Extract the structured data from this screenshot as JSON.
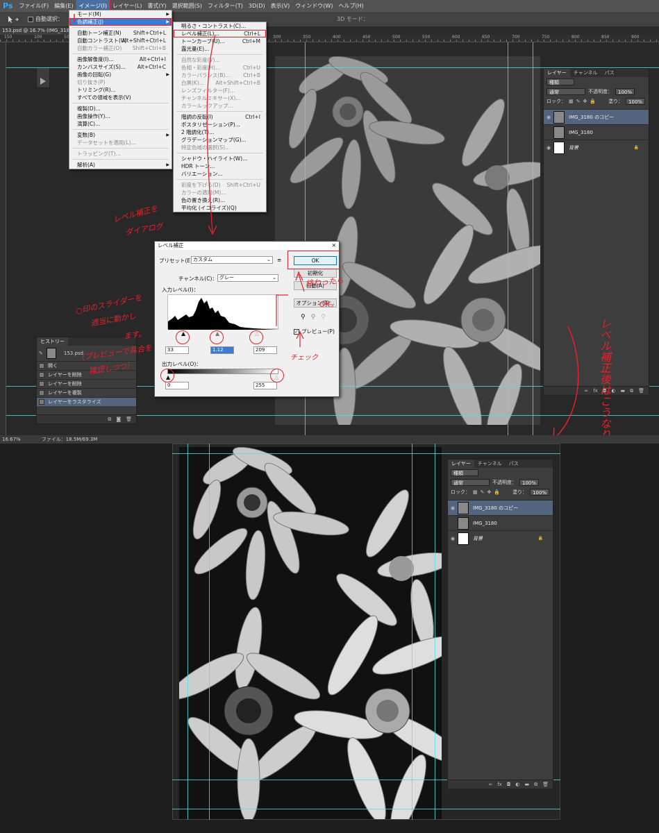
{
  "menubar": {
    "logo": "Ps",
    "items": [
      "ファイル(F)",
      "編集(E)",
      "イメージ(I)",
      "レイヤー(L)",
      "書式(Y)",
      "選択範囲(S)",
      "フィルター(T)",
      "3D(D)",
      "表示(V)",
      "ウィンドウ(W)",
      "ヘルプ(H)"
    ]
  },
  "optbar": {
    "auto_select": "自動選択：",
    "mode3d": "3D モード："
  },
  "doc_tab": "153.psd @ 16.7% (IMG_3180",
  "ruler_numbers": [
    "150",
    "100",
    "50",
    "0",
    "50",
    "100",
    "150",
    "200",
    "250",
    "300",
    "350",
    "400",
    "450",
    "500",
    "550",
    "600",
    "650",
    "700",
    "750",
    "800",
    "850",
    "900",
    "950"
  ],
  "image_menu": {
    "items": [
      {
        "label": "モード(M)",
        "sc": "",
        "arrow": true,
        "state": ""
      },
      {
        "label": "色調補正(J)",
        "sc": "",
        "arrow": true,
        "state": "sel"
      },
      {
        "label": "sep"
      },
      {
        "label": "自動トーン補正(N)",
        "sc": "Shift+Ctrl+L",
        "state": ""
      },
      {
        "label": "自動コントラスト(U)",
        "sc": "Alt+Shift+Ctrl+L",
        "state": ""
      },
      {
        "label": "自動カラー補正(O)",
        "sc": "Shift+Ctrl+B",
        "state": "dis"
      },
      {
        "label": "sep"
      },
      {
        "label": "画像解像度(I)...",
        "sc": "Alt+Ctrl+I",
        "state": ""
      },
      {
        "label": "カンバスサイズ(S)...",
        "sc": "Alt+Ctrl+C",
        "state": ""
      },
      {
        "label": "画像の回転(G)",
        "sc": "",
        "arrow": true,
        "state": ""
      },
      {
        "label": "切り抜き(P)",
        "sc": "",
        "state": "dis"
      },
      {
        "label": "トリミング(R)...",
        "sc": "",
        "state": ""
      },
      {
        "label": "すべての領域を表示(V)",
        "sc": "",
        "state": ""
      },
      {
        "label": "sep"
      },
      {
        "label": "複製(D)...",
        "sc": "",
        "state": ""
      },
      {
        "label": "画像操作(Y)...",
        "sc": "",
        "state": ""
      },
      {
        "label": "演算(C)...",
        "sc": "",
        "state": ""
      },
      {
        "label": "sep"
      },
      {
        "label": "変数(B)",
        "sc": "",
        "arrow": true,
        "state": ""
      },
      {
        "label": "データセットを適用(L)...",
        "sc": "",
        "state": "dis"
      },
      {
        "label": "sep"
      },
      {
        "label": "トラッピング(T)...",
        "sc": "",
        "state": "dis"
      },
      {
        "label": "sep"
      },
      {
        "label": "解析(A)",
        "sc": "",
        "arrow": true,
        "state": ""
      }
    ]
  },
  "adjust_menu": {
    "items": [
      {
        "label": "明るさ・コントラスト(C)...",
        "sc": "",
        "state": ""
      },
      {
        "label": "レベル補正(L)...",
        "sc": "Ctrl+L",
        "state": "hl"
      },
      {
        "label": "トーンカーブ(U)...",
        "sc": "Ctrl+M",
        "state": ""
      },
      {
        "label": "露光量(E)...",
        "sc": "",
        "state": ""
      },
      {
        "label": "sep"
      },
      {
        "label": "自然な彩度(V)...",
        "sc": "",
        "state": "dis"
      },
      {
        "label": "色相・彩度(H)...",
        "sc": "Ctrl+U",
        "state": "dis"
      },
      {
        "label": "カラーバランス(B)...",
        "sc": "Ctrl+B",
        "state": "dis"
      },
      {
        "label": "白黒(K)...",
        "sc": "Alt+Shift+Ctrl+B",
        "state": "dis"
      },
      {
        "label": "レンズフィルター(F)...",
        "sc": "",
        "state": "dis"
      },
      {
        "label": "チャンネルミキサー(X)...",
        "sc": "",
        "state": "dis"
      },
      {
        "label": "カラールックアップ...",
        "sc": "",
        "state": "dis"
      },
      {
        "label": "sep"
      },
      {
        "label": "階調の反転(I)",
        "sc": "Ctrl+I",
        "state": ""
      },
      {
        "label": "ポスタリゼーション(P)...",
        "sc": "",
        "state": ""
      },
      {
        "label": "2 階調化(T)...",
        "sc": "",
        "state": ""
      },
      {
        "label": "グラデーションマップ(G)...",
        "sc": "",
        "state": ""
      },
      {
        "label": "特定色域の選択(S)...",
        "sc": "",
        "state": "dis"
      },
      {
        "label": "sep"
      },
      {
        "label": "シャドウ・ハイライト(W)...",
        "sc": "",
        "state": ""
      },
      {
        "label": "HDR トーン...",
        "sc": "",
        "state": ""
      },
      {
        "label": "バリエーション...",
        "sc": "",
        "state": ""
      },
      {
        "label": "sep"
      },
      {
        "label": "彩度を下げる(D)",
        "sc": "Shift+Ctrl+U",
        "state": "dis"
      },
      {
        "label": "カラーの適用(M)...",
        "sc": "",
        "state": "dis"
      },
      {
        "label": "色の置き換え(R)...",
        "sc": "",
        "state": ""
      },
      {
        "label": "平均化 (イコライズ)(Q)",
        "sc": "",
        "state": ""
      }
    ]
  },
  "levels_dialog": {
    "title": "レベル補正",
    "close": "✕",
    "preset_label": "プリセット(E)：",
    "preset_value": "カスタム",
    "channel_label": "チャンネル(C)：",
    "channel_value": "グレー",
    "input_label": "入力レベル(I)：",
    "input_black": "33",
    "input_mid": "1.12",
    "input_white": "209",
    "output_label": "出力レベル(O)：",
    "output_black": "0",
    "output_white": "255",
    "ok": "OK",
    "reset": "初期化",
    "auto": "自動(A)",
    "options": "オプション(T)...",
    "preview": "プレビュー(P)"
  },
  "history_panel": {
    "tab": "ヒストリー",
    "snapshot": "153.psd",
    "items": [
      "開く",
      "レイヤーを削除",
      "レイヤーを削除",
      "レイヤーを複製",
      "レイヤーをラスタライズ"
    ],
    "selected": 4
  },
  "layers_panel_top": {
    "tabs": [
      "レイヤー",
      "チャンネル",
      "パス"
    ],
    "kind": "種類",
    "blend": "通常",
    "opacity_label": "不透明度：",
    "opacity": "100%",
    "lock_label": "ロック：",
    "fill_label": "塗り：",
    "fill": "100%",
    "layers": [
      "IMG_3180 のコピー",
      "IMG_3180",
      "背景"
    ]
  },
  "layers_panel_bottom": {
    "tabs": [
      "レイヤー",
      "チャンネル",
      "パス"
    ],
    "kind": "種類",
    "blend": "通常",
    "opacity_label": "不透明度：",
    "opacity": "100%",
    "lock_label": "ロック：",
    "fill_label": "塗り：",
    "fill": "100%",
    "layers": [
      "IMG_3180 のコピー",
      "IMG_3180",
      "背景"
    ]
  },
  "statusbar": {
    "zoom": "16.67%",
    "file": "ファイル：18.5M/69.3M"
  },
  "annotations": {
    "open_dialog_1": "レベル補正を",
    "open_dialog_2": "ダイアログ",
    "slider_1": "○印のスライダーを",
    "slider_2": "適当に動かし",
    "slider_3": "ます。",
    "slider_4": "（プレビューで具合を",
    "slider_5": "確認しつつ）",
    "done_1": "終わったら",
    "done_2": "OK。",
    "check": "チェック",
    "after_v": "レベル補正後はこうなりました。"
  },
  "colors": {
    "accent": "#e8202a",
    "guide": "#4ee0e6",
    "selection": "#3d7bd1"
  }
}
